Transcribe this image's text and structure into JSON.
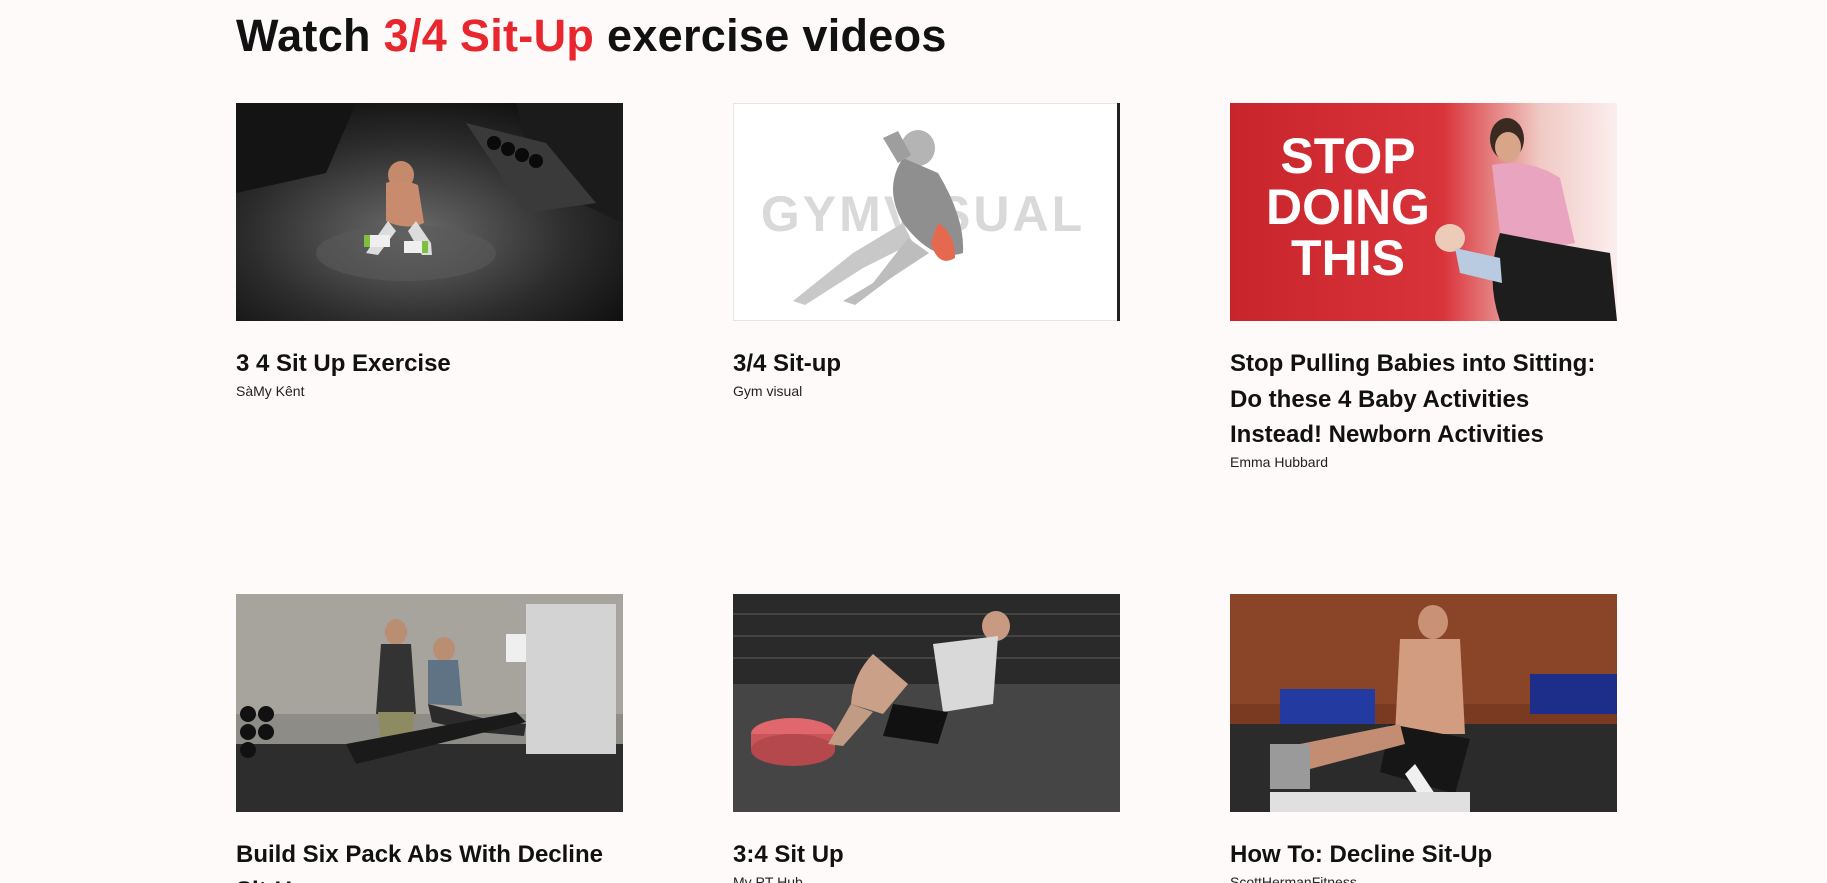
{
  "heading": {
    "prefix": "Watch ",
    "exercise": "3/4 Sit-Up",
    "suffix": " exercise videos"
  },
  "videos": [
    {
      "title": "3 4 Sit Up Exercise",
      "author": "SàMy Kênt"
    },
    {
      "title": "3/4 Sit-up",
      "author": "Gym visual",
      "thumb_text": "GYMVISUAL"
    },
    {
      "title": "Stop Pulling Babies into Sitting: Do these 4 Baby Activities Instead! Newborn Activities",
      "author": "Emma Hubbard",
      "thumb_text": [
        "STOP",
        "DOING",
        "THIS"
      ]
    },
    {
      "title": "Build Six Pack Abs With Decline Sit-Up",
      "author": ""
    },
    {
      "title": "3:4 Sit Up",
      "author": "My PT Hub"
    },
    {
      "title": "How To: Decline Sit-Up",
      "author": "ScottHermanFitness"
    }
  ],
  "colors": {
    "accent": "#e8262e",
    "background": "#fffafa"
  }
}
